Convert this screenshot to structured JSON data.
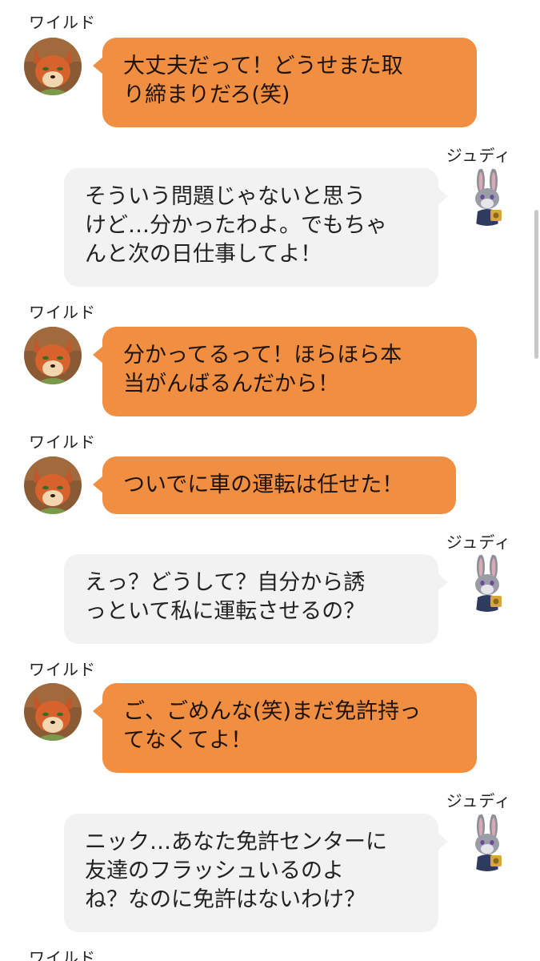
{
  "chat": {
    "messages": [
      {
        "speaker": "ワイルド",
        "side": "left",
        "avatar_icon": "fox-avatar-icon",
        "text": "大丈夫だって！どうせまた取\nり締まりだろ(笑)"
      },
      {
        "speaker": "ジュディ",
        "side": "right",
        "avatar_icon": "rabbit-avatar-icon",
        "text": "そういう問題じゃないと思う\nけど…分かったわよ。でもちゃ\nんと次の日仕事してよ！"
      },
      {
        "speaker": "ワイルド",
        "side": "left",
        "avatar_icon": "fox-avatar-icon",
        "text": "分かってるって！ほらほら本\n当がんばるんだから！"
      },
      {
        "speaker": "ワイルド",
        "side": "left",
        "avatar_icon": "fox-avatar-icon",
        "text": "ついでに車の運転は任せた！"
      },
      {
        "speaker": "ジュディ",
        "side": "right",
        "avatar_icon": "rabbit-avatar-icon",
        "text": "えっ？どうして？自分から誘\nっといて私に運転させるの？"
      },
      {
        "speaker": "ワイルド",
        "side": "left",
        "avatar_icon": "fox-avatar-icon",
        "text": "ご、ごめんな(笑)まだ免許持っ\nてなくてよ！"
      },
      {
        "speaker": "ジュディ",
        "side": "right",
        "avatar_icon": "rabbit-avatar-icon",
        "text": "ニック…あなた免許センターに\n友達のフラッシュいるのよ\nね？なのに免許はないわけ？"
      },
      {
        "speaker": "ワイルド",
        "side": "left"
      }
    ]
  },
  "colors": {
    "outgoing_bubble": "#f08f42",
    "incoming_bubble": "#f2f2f2",
    "background": "#ffffff"
  }
}
